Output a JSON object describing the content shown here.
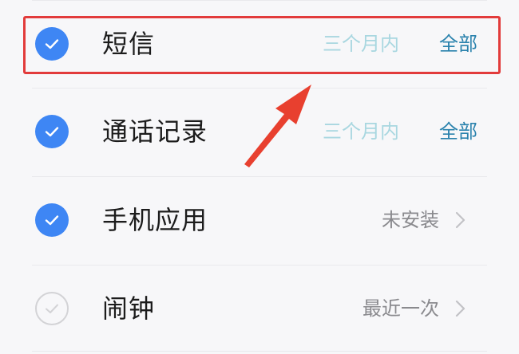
{
  "items": [
    {
      "label": "短信",
      "range": "三个月内",
      "all": "全部",
      "checked": true
    },
    {
      "label": "通话记录",
      "range": "三个月内",
      "all": "全部",
      "checked": true
    },
    {
      "label": "手机应用",
      "status": "未安装",
      "checked": true
    },
    {
      "label": "闹钟",
      "status": "最近一次",
      "checked": false
    }
  ],
  "colors": {
    "check_on": "#3e86f4",
    "highlight": "#e23b3b",
    "range_text": "#a9d7e0",
    "all_link": "#2a82ad"
  },
  "icons": {
    "checked": "checkmark-circle-icon",
    "unchecked": "empty-circle-icon",
    "chevron": "chevron-right-icon",
    "annotation": "red-arrow-icon"
  }
}
